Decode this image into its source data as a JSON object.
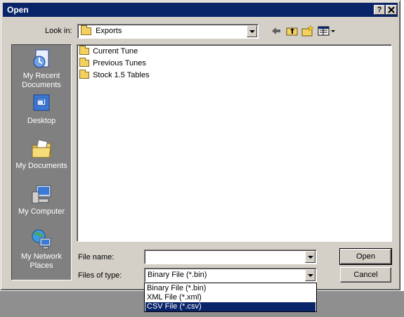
{
  "window": {
    "title": "Open",
    "help_button": "?",
    "close_button": "X"
  },
  "look_in": {
    "label": "Look in:",
    "value": "Exports"
  },
  "places": [
    {
      "label": "My Recent Documents",
      "icon": "recent-documents-icon"
    },
    {
      "label": "Desktop",
      "icon": "desktop-icon"
    },
    {
      "label": "My Documents",
      "icon": "my-documents-icon"
    },
    {
      "label": "My Computer",
      "icon": "my-computer-icon"
    },
    {
      "label": "My Network Places",
      "icon": "network-places-icon"
    }
  ],
  "files": [
    {
      "name": "Current Tune",
      "icon": "folder-icon"
    },
    {
      "name": "Previous Tunes",
      "icon": "folder-icon"
    },
    {
      "name": "Stock 1.5 Tables",
      "icon": "folder-icon"
    }
  ],
  "file_name": {
    "label": "File name:",
    "value": ""
  },
  "file_type": {
    "label": "Files of type:",
    "value": "Binary File (*.bin)",
    "options": [
      "Binary File (*.bin)",
      "XML File (*.xml)",
      "CSV File (*.csv)"
    ],
    "highlighted": "CSV File (*.csv)"
  },
  "buttons": {
    "open": "Open",
    "cancel": "Cancel"
  },
  "colors": {
    "titlebar": "#0a246a",
    "dialog": "#d4d0c8",
    "selection": "#0a246a"
  }
}
